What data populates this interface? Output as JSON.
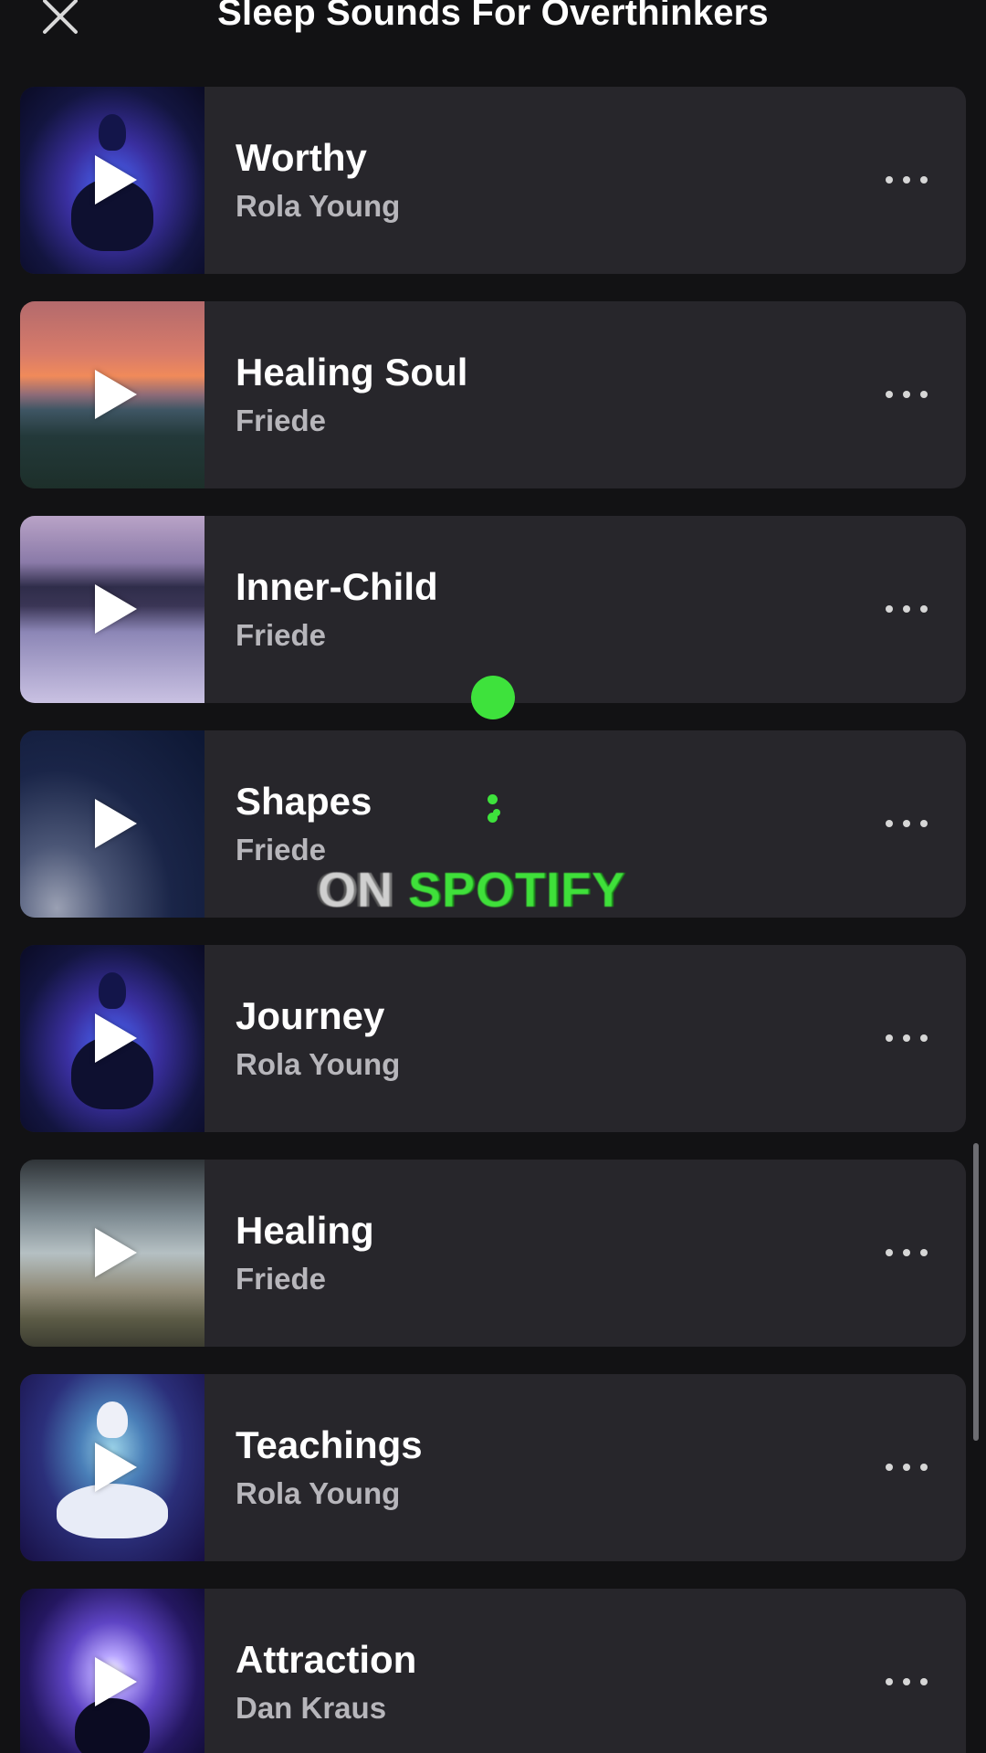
{
  "header": {
    "close_icon": "close-icon",
    "title": "Sleep Sounds For Overthinkers"
  },
  "tracks": [
    {
      "title": "Worthy",
      "artist": "Rola Young",
      "art": "meditation-chakra-art"
    },
    {
      "title": "Healing Soul",
      "artist": "Friede",
      "art": "sunset-lake-art"
    },
    {
      "title": "Inner-Child",
      "artist": "Friede",
      "art": "purple-lake-art"
    },
    {
      "title": "Shapes",
      "artist": "Friede",
      "art": "crescent-moon-art"
    },
    {
      "title": "Journey",
      "artist": "Rola Young",
      "art": "meditation-chakra-art"
    },
    {
      "title": "Healing",
      "artist": "Friede",
      "art": "beach-path-art"
    },
    {
      "title": "Teachings",
      "artist": "Rola Young",
      "art": "meditation-figure-art"
    },
    {
      "title": "Attraction",
      "artist": "Dan Kraus",
      "art": "cosmic-meditation-art"
    }
  ],
  "overlay": {
    "prefix": "ON",
    "brand": "SPOTIFY",
    "accent_color": "#3ee23c"
  },
  "colors": {
    "background": "#121214",
    "row_background": "#27262b",
    "artist_text": "#b7b6bb"
  }
}
